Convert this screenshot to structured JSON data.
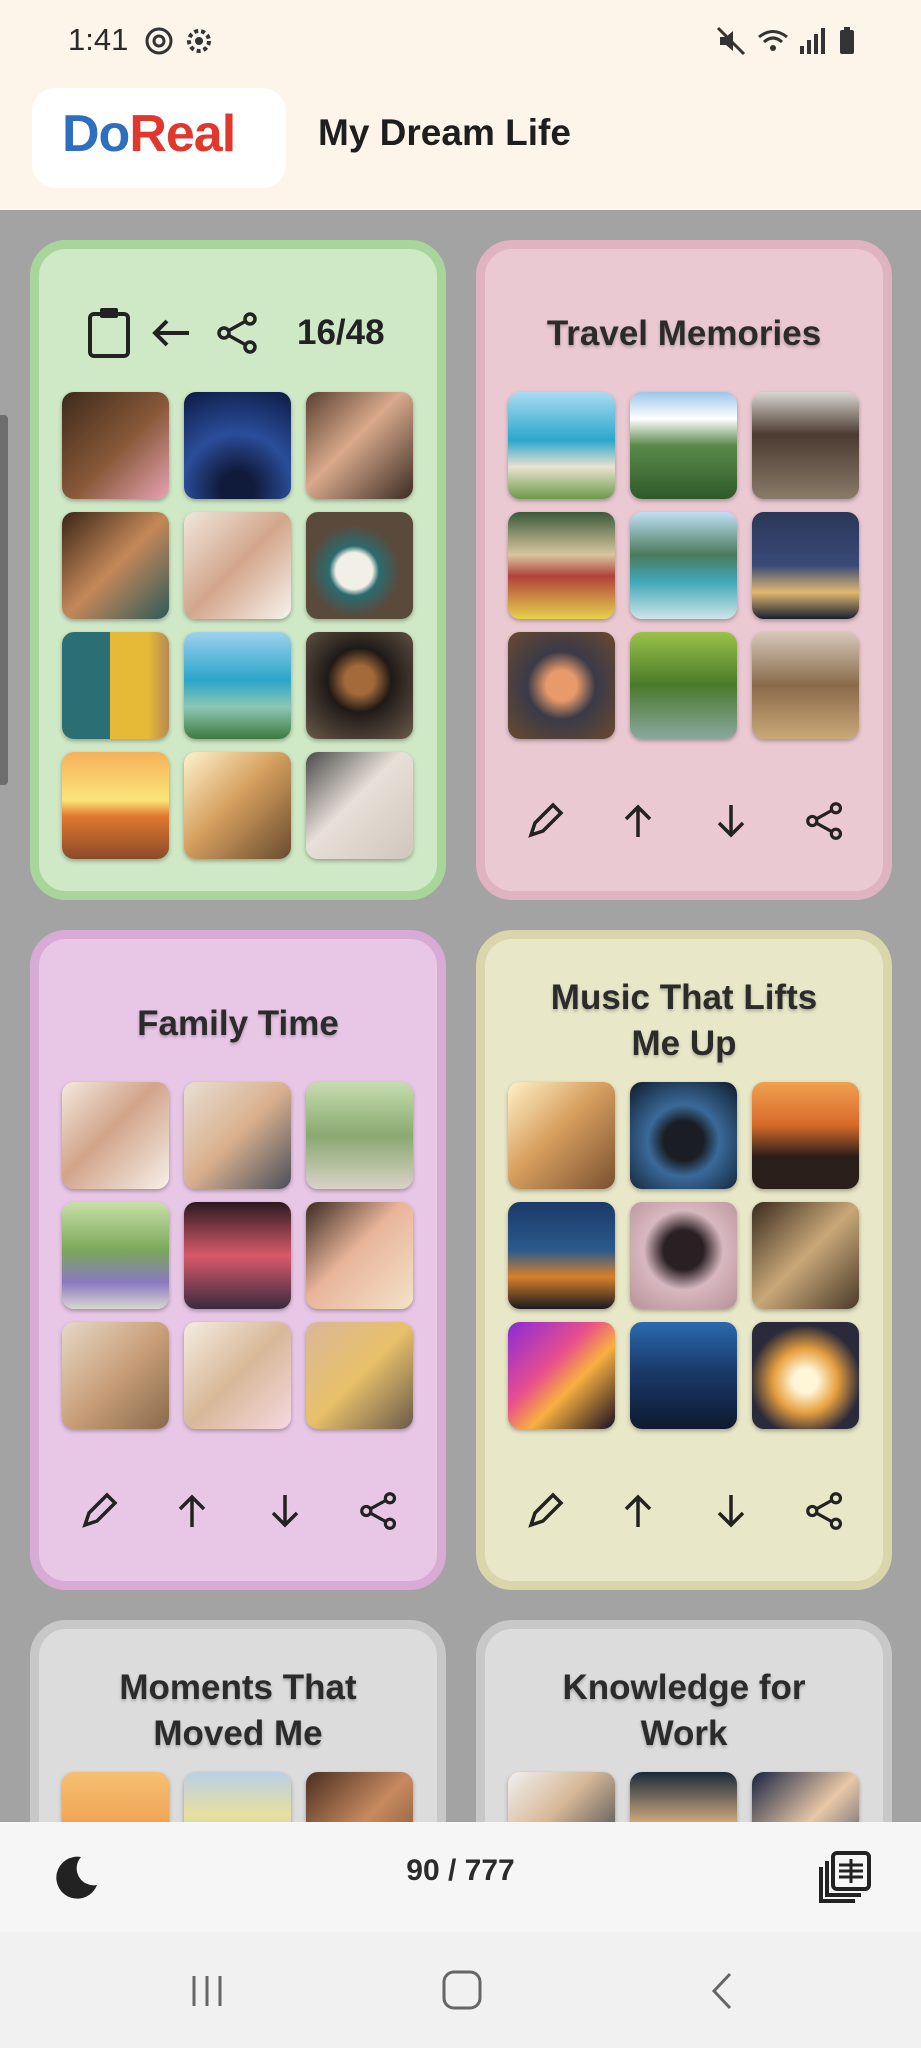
{
  "status_bar": {
    "time": "1:41"
  },
  "header": {
    "logo_part1": "Do",
    "logo_part2": "Real",
    "title": "My Dream Life"
  },
  "cards": [
    {
      "id": "current",
      "pager": "16/48",
      "thumbs": [
        "dog-with-flowers",
        "starry-sky-silhouette",
        "laughing-women",
        "family-dinner",
        "mother-daughter-laughing",
        "clock",
        "toy-blocks",
        "woman-on-beach",
        "puppy",
        "sunset-over-sea",
        "headphones-by-window",
        "woman-talking"
      ]
    },
    {
      "id": "travel",
      "title": "Travel Memories",
      "thumbs": [
        "woman-on-beach",
        "mountain-valley",
        "old-street",
        "retro-train",
        "lake-mountains",
        "city-night-view",
        "japanese-meal",
        "forest-stream",
        "woman-backpack"
      ]
    },
    {
      "id": "family",
      "title": "Family Time",
      "thumbs": [
        "mother-daughter-laughing",
        "father-child",
        "child-running",
        "child-on-bike",
        "family-in-yukata",
        "girl-clapping",
        "friends-toasting",
        "child-with-card",
        "group-of-kids"
      ]
    },
    {
      "id": "music",
      "title": "Music That Lifts Me Up",
      "thumbs": [
        "headphones-by-window",
        "headphones-soundwave",
        "car-sunset-road",
        "speaker-rainy-window",
        "headphones-on-blanket",
        "cassette-tapes",
        "dancing-silhouette",
        "headphones-night",
        "glowing-headphones"
      ]
    },
    {
      "id": "moments",
      "title": "Moments That Moved Me",
      "thumbs": [
        "sunrise",
        "rainbow",
        "hands-holding"
      ]
    },
    {
      "id": "knowledge",
      "title": "Knowledge for Work",
      "thumbs": [
        "businessman",
        "writing-notes",
        "woman-at-desk"
      ]
    }
  ],
  "footer": {
    "counter": "90 / 777"
  },
  "colors": {
    "card_green": "#cfe8c6",
    "card_pink": "#ebc9d3",
    "card_violet": "#e8c7e6",
    "card_olive": "#e8e7c8",
    "card_gray": "#dcdcdc"
  }
}
